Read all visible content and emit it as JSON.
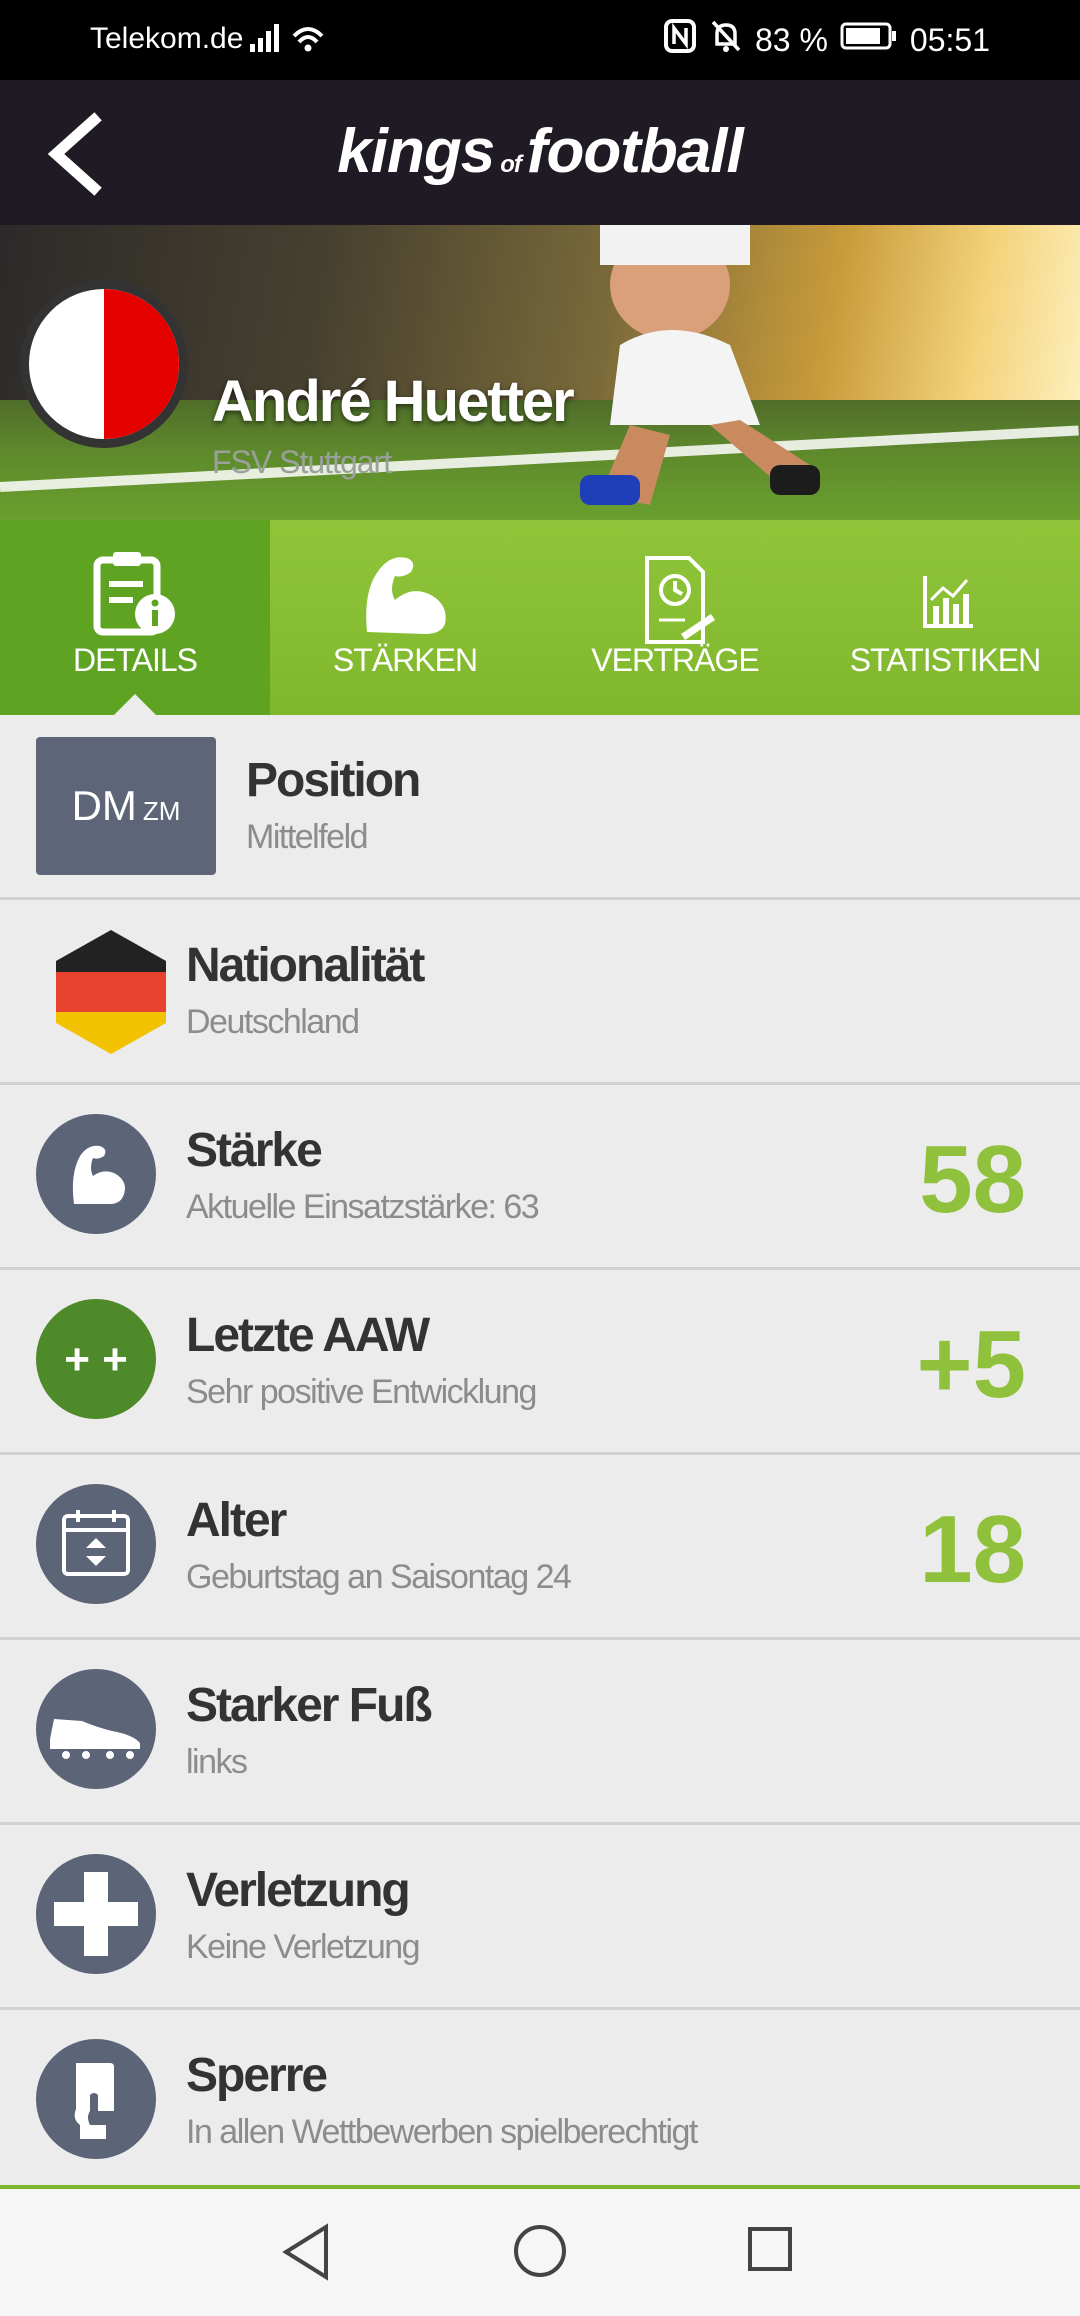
{
  "status_bar": {
    "carrier": "Telekom.de",
    "battery": "83 %",
    "time": "05:51",
    "icons": [
      "signal-icon",
      "wifi-icon",
      "nfc-icon",
      "bell-off-icon",
      "battery-icon"
    ]
  },
  "app": {
    "logo_main_left": "kings",
    "logo_of": "of",
    "logo_main_right": "football",
    "back_icon": "back-arrow-icon"
  },
  "player": {
    "name": "André Huetter",
    "club": "FSV Stuttgart",
    "club_colors": [
      "#ffffff",
      "#e50000"
    ]
  },
  "tabs": [
    {
      "label": "DETAILS",
      "icon": "clipboard-info-icon",
      "active": true
    },
    {
      "label": "STÄRKEN",
      "icon": "flexed-arm-icon",
      "active": false
    },
    {
      "label": "VERTRÄGE",
      "icon": "contract-clock-icon",
      "active": false
    },
    {
      "label": "STATISTIKEN",
      "icon": "bar-chart-icon",
      "active": false
    }
  ],
  "details": {
    "position": {
      "badge_main": "DM",
      "badge_small": "ZM",
      "title": "Position",
      "value": "Mittelfeld"
    },
    "nationality": {
      "title": "Nationalität",
      "value": "Deutschland",
      "icon": "germany-flag-icon"
    },
    "strength": {
      "title": "Stärke",
      "value": "Aktuelle Einsatzstärke: 63",
      "number": "58",
      "icon": "flexed-arm-icon"
    },
    "last_aaw": {
      "title": "Letzte AAW",
      "value": "Sehr positive Entwicklung",
      "number": "+5",
      "icon_text": "+ +"
    },
    "age": {
      "title": "Alter",
      "value": "Geburtstag an Saisontag 24",
      "number": "18",
      "icon": "calendar-icon"
    },
    "strong_foot": {
      "title": "Starker Fuß",
      "value": "links",
      "icon": "football-boot-icon"
    },
    "injury": {
      "title": "Verletzung",
      "value": "Keine Verletzung",
      "icon": "cross-icon"
    },
    "suspension": {
      "title": "Sperre",
      "value": "In allen Wettbewerben spielberechtigt",
      "icon": "card-hand-icon"
    }
  },
  "colors": {
    "accent_green": "#8fc13c",
    "tab_green": "#7fb72c",
    "tab_active": "#5fa322",
    "header": "#1f1a24",
    "icon_bg": "#5c6478",
    "aaw_bg": "#4e8a2a"
  },
  "navbar": {
    "icons": [
      "nav-back-icon",
      "nav-home-icon",
      "nav-recents-icon"
    ]
  }
}
